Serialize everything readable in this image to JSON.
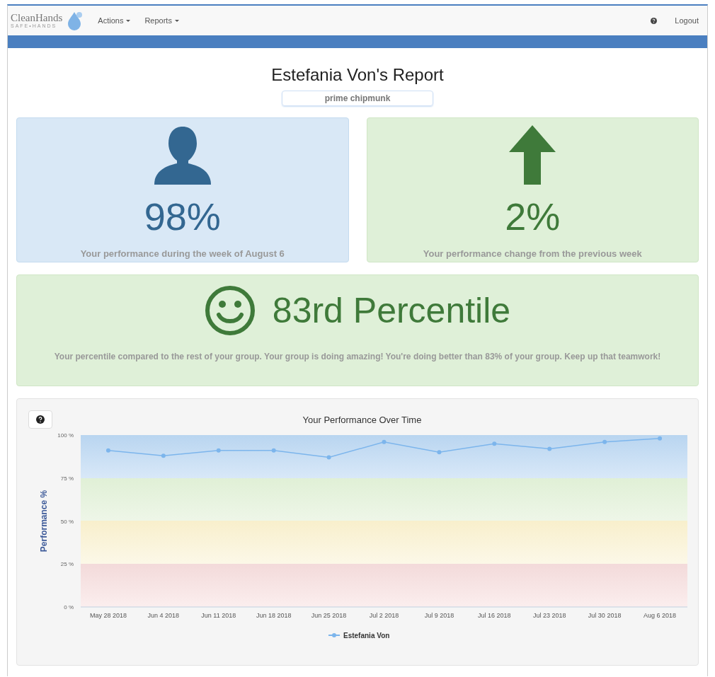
{
  "navbar": {
    "logo": {
      "name": "CleanHands",
      "tagline": "SAFE•HANDS"
    },
    "menus": [
      {
        "label": "Actions"
      },
      {
        "label": "Reports"
      }
    ],
    "logout": "Logout"
  },
  "report": {
    "title": "Estefania Von's Report",
    "nickname": "prime chipmunk"
  },
  "cards": [
    {
      "kind": "person",
      "value": "98%",
      "caption": "Your performance during the week of August 6"
    },
    {
      "kind": "up",
      "value": "2%",
      "caption": "Your performance change from the previous week"
    }
  ],
  "percentile": {
    "value": "83rd Percentile",
    "caption": "Your percentile compared to the rest of your group. Your group is doing amazing! You're doing better than 83% of your group. Keep up that teamwork!"
  },
  "chart_panel": {
    "chart_data": {
      "type": "line",
      "title": "Your Performance Over Time",
      "ylabel": "Performance %",
      "categories": [
        "May 28 2018",
        "Jun 4 2018",
        "Jun 11 2018",
        "Jun 18 2018",
        "Jun 25 2018",
        "Jul 2 2018",
        "Jul 9 2018",
        "Jul 16 2018",
        "Jul 23 2018",
        "Jul 30 2018",
        "Aug 6 2018"
      ],
      "series": [
        {
          "name": "Estefania Von",
          "color": "#7cb5ec",
          "values": [
            91,
            88,
            91,
            91,
            87,
            96,
            90,
            95,
            92,
            96,
            98
          ],
          "marker": "circle"
        }
      ],
      "ylim": [
        0,
        100
      ],
      "yticks": [
        {
          "value": 0,
          "label": "0 %"
        },
        {
          "value": 25,
          "label": "25 %"
        },
        {
          "value": 50,
          "label": "50 %"
        },
        {
          "value": 75,
          "label": "75 %"
        },
        {
          "value": 100,
          "label": "100 %"
        }
      ]
    }
  }
}
